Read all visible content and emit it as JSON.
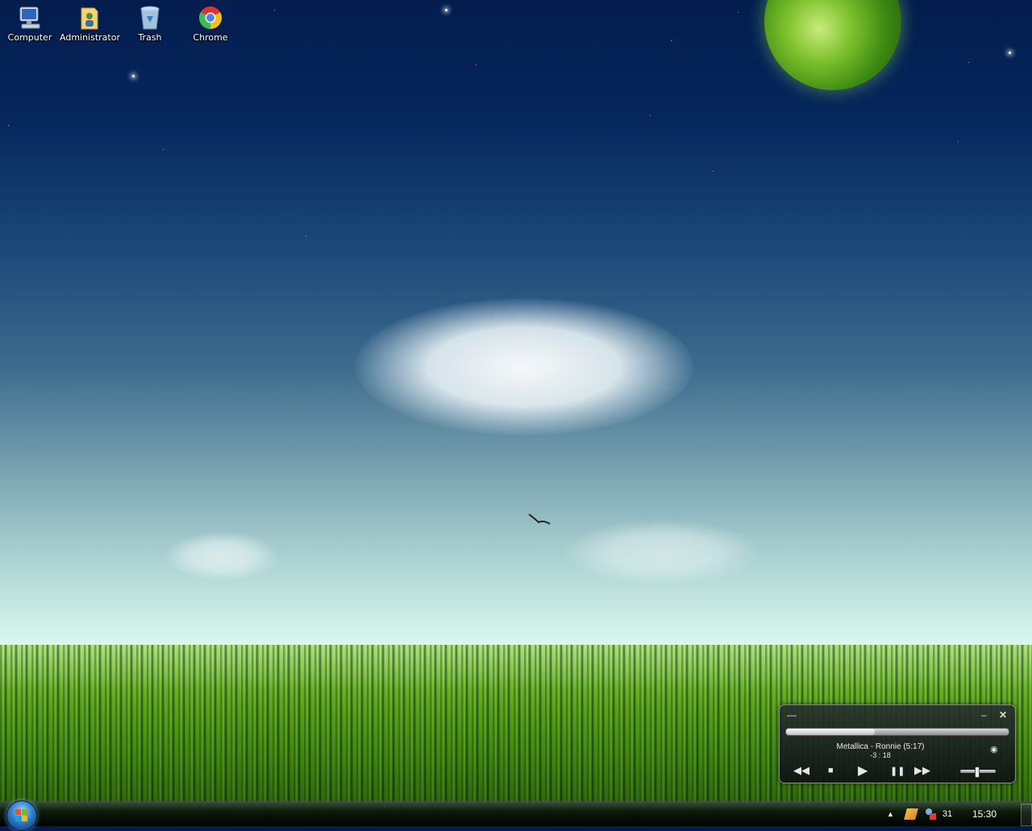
{
  "desktop": {
    "icons": [
      {
        "label": "Computer",
        "icon": "computer-icon"
      },
      {
        "label": "Administrator",
        "icon": "user-folder-icon"
      },
      {
        "label": "Trash",
        "icon": "trash-icon"
      },
      {
        "label": "Chrome",
        "icon": "chrome-icon"
      }
    ]
  },
  "player": {
    "track_title": "Metallica - Ronnie (5:17)",
    "time_remaining": "-3 : 18",
    "progress": 0.4,
    "volume": 0.45,
    "buttons": [
      "rewind-icon",
      "stop-icon",
      "play-icon",
      "pause-icon",
      "fast-forward-icon"
    ]
  },
  "taskbar": {
    "tray_number": "31",
    "clock": "15:30"
  },
  "colors": {
    "sky_top": "#021c4e",
    "grass": "#3d8a12",
    "taskbar": "#0a140a"
  }
}
